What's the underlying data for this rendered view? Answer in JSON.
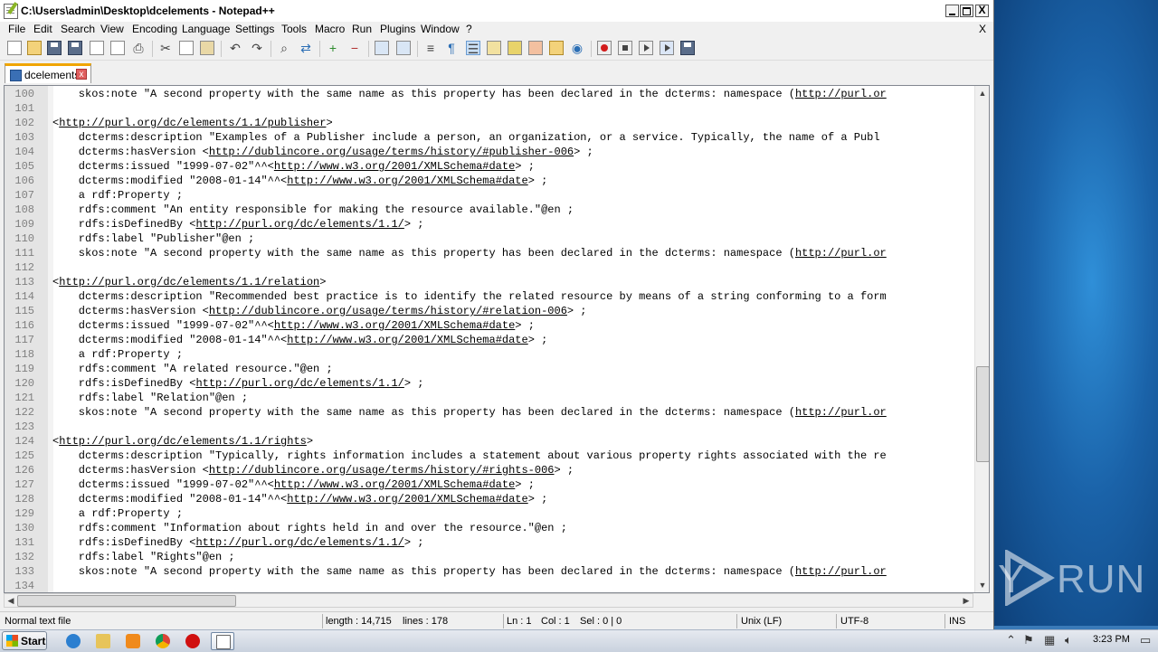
{
  "window": {
    "title": "C:\\Users\\admin\\Desktop\\dcelements - Notepad++",
    "close_glyph": "X"
  },
  "menu": [
    "File",
    "Edit",
    "Search",
    "View",
    "Encoding",
    "Language",
    "Settings",
    "Tools",
    "Macro",
    "Run",
    "Plugins",
    "Window",
    "?"
  ],
  "menu_close": "X",
  "tab": {
    "label": "dcelements",
    "close_glyph": "x"
  },
  "editor_lines": [
    {
      "n": "100",
      "t": "    skos:note \"A second property with the same name as this property has been declared in the dcterms: namespace (",
      "u": "http://purl.or",
      "e": ""
    },
    {
      "n": "101",
      "t": "",
      "u": "",
      "e": ""
    },
    {
      "n": "102",
      "t": "<",
      "u": "http://purl.org/dc/elements/1.1/publisher",
      "e": ">"
    },
    {
      "n": "103",
      "t": "    dcterms:description \"Examples of a Publisher include a person, an organization, or a service. Typically, the name of a Publ",
      "u": "",
      "e": ""
    },
    {
      "n": "104",
      "t": "    dcterms:hasVersion <",
      "u": "http://dublincore.org/usage/terms/history/#publisher-006",
      "e": "> ;"
    },
    {
      "n": "105",
      "t": "    dcterms:issued \"1999-07-02\"^^<",
      "u": "http://www.w3.org/2001/XMLSchema#date",
      "e": "> ;"
    },
    {
      "n": "106",
      "t": "    dcterms:modified \"2008-01-14\"^^<",
      "u": "http://www.w3.org/2001/XMLSchema#date",
      "e": "> ;"
    },
    {
      "n": "107",
      "t": "    a rdf:Property ;",
      "u": "",
      "e": ""
    },
    {
      "n": "108",
      "t": "    rdfs:comment \"An entity responsible for making the resource available.\"@en ;",
      "u": "",
      "e": ""
    },
    {
      "n": "109",
      "t": "    rdfs:isDefinedBy <",
      "u": "http://purl.org/dc/elements/1.1/",
      "e": "> ;"
    },
    {
      "n": "110",
      "t": "    rdfs:label \"Publisher\"@en ;",
      "u": "",
      "e": ""
    },
    {
      "n": "111",
      "t": "    skos:note \"A second property with the same name as this property has been declared in the dcterms: namespace (",
      "u": "http://purl.or",
      "e": ""
    },
    {
      "n": "112",
      "t": "",
      "u": "",
      "e": ""
    },
    {
      "n": "113",
      "t": "<",
      "u": "http://purl.org/dc/elements/1.1/relation",
      "e": ">"
    },
    {
      "n": "114",
      "t": "    dcterms:description \"Recommended best practice is to identify the related resource by means of a string conforming to a form",
      "u": "",
      "e": ""
    },
    {
      "n": "115",
      "t": "    dcterms:hasVersion <",
      "u": "http://dublincore.org/usage/terms/history/#relation-006",
      "e": "> ;"
    },
    {
      "n": "116",
      "t": "    dcterms:issued \"1999-07-02\"^^<",
      "u": "http://www.w3.org/2001/XMLSchema#date",
      "e": "> ;"
    },
    {
      "n": "117",
      "t": "    dcterms:modified \"2008-01-14\"^^<",
      "u": "http://www.w3.org/2001/XMLSchema#date",
      "e": "> ;"
    },
    {
      "n": "118",
      "t": "    a rdf:Property ;",
      "u": "",
      "e": ""
    },
    {
      "n": "119",
      "t": "    rdfs:comment \"A related resource.\"@en ;",
      "u": "",
      "e": ""
    },
    {
      "n": "120",
      "t": "    rdfs:isDefinedBy <",
      "u": "http://purl.org/dc/elements/1.1/",
      "e": "> ;"
    },
    {
      "n": "121",
      "t": "    rdfs:label \"Relation\"@en ;",
      "u": "",
      "e": ""
    },
    {
      "n": "122",
      "t": "    skos:note \"A second property with the same name as this property has been declared in the dcterms: namespace (",
      "u": "http://purl.or",
      "e": ""
    },
    {
      "n": "123",
      "t": "",
      "u": "",
      "e": ""
    },
    {
      "n": "124",
      "t": "<",
      "u": "http://purl.org/dc/elements/1.1/rights",
      "e": ">"
    },
    {
      "n": "125",
      "t": "    dcterms:description \"Typically, rights information includes a statement about various property rights associated with the re",
      "u": "",
      "e": ""
    },
    {
      "n": "126",
      "t": "    dcterms:hasVersion <",
      "u": "http://dublincore.org/usage/terms/history/#rights-006",
      "e": "> ;"
    },
    {
      "n": "127",
      "t": "    dcterms:issued \"1999-07-02\"^^<",
      "u": "http://www.w3.org/2001/XMLSchema#date",
      "e": "> ;"
    },
    {
      "n": "128",
      "t": "    dcterms:modified \"2008-01-14\"^^<",
      "u": "http://www.w3.org/2001/XMLSchema#date",
      "e": "> ;"
    },
    {
      "n": "129",
      "t": "    a rdf:Property ;",
      "u": "",
      "e": ""
    },
    {
      "n": "130",
      "t": "    rdfs:comment \"Information about rights held in and over the resource.\"@en ;",
      "u": "",
      "e": ""
    },
    {
      "n": "131",
      "t": "    rdfs:isDefinedBy <",
      "u": "http://purl.org/dc/elements/1.1/",
      "e": "> ;"
    },
    {
      "n": "132",
      "t": "    rdfs:label \"Rights\"@en ;",
      "u": "",
      "e": ""
    },
    {
      "n": "133",
      "t": "    skos:note \"A second property with the same name as this property has been declared in the dcterms: namespace (",
      "u": "http://purl.or",
      "e": ""
    },
    {
      "n": "134",
      "t": "",
      "u": "",
      "e": ""
    }
  ],
  "status": {
    "file_type": "Normal text file",
    "length": "length : 14,715",
    "lines": "lines : 178",
    "ln": "Ln : 1",
    "col": "Col : 1",
    "sel": "Sel : 0 | 0",
    "eol": "Unix (LF)",
    "encoding": "UTF-8",
    "mode": "INS"
  },
  "taskbar": {
    "start_label": "Start",
    "clock": "3:23 PM"
  },
  "watermark": {
    "left": "ANY",
    "right": "RUN"
  },
  "colors": {
    "tab_accent": "#f0a500",
    "desktop": "#1a62a8",
    "url": "#000000"
  },
  "icons": {
    "toolbar": [
      "new-file-icon",
      "open-file-icon",
      "save-icon",
      "save-all-icon",
      "close-icon",
      "close-all-icon",
      "print-icon",
      "cut-icon",
      "copy-icon",
      "paste-icon",
      "undo-icon",
      "redo-icon",
      "find-icon",
      "replace-icon",
      "zoom-in-icon",
      "zoom-out-icon",
      "sync-v-icon",
      "sync-h-icon",
      "word-wrap-icon",
      "show-all-chars-icon",
      "indent-guide-icon",
      "udl-icon",
      "doc-map-icon",
      "function-list-icon",
      "folder-workspace-icon",
      "monitor-icon",
      "record-macro-icon",
      "stop-record-icon",
      "play-macro-icon",
      "run-macro-multiple-icon",
      "save-macro-icon"
    ]
  }
}
